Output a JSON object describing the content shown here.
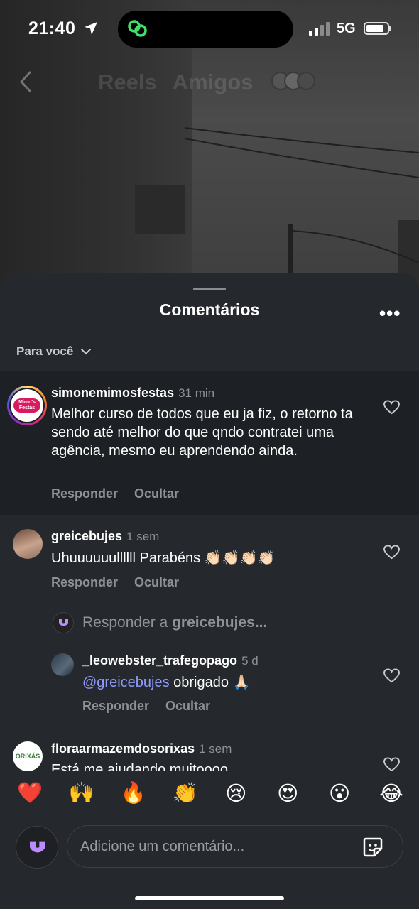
{
  "status_bar": {
    "time": "21:40",
    "network": "5G"
  },
  "reel_header": {
    "tabs": [
      "Reels",
      "Amigos"
    ]
  },
  "sheet": {
    "title": "Comentários",
    "more": "•••",
    "filter_label": "Para você"
  },
  "comments": [
    {
      "username": "simonemimosfestas",
      "time": "31 min",
      "text": "Melhor curso de todos que eu ja fiz, o retorno ta sendo até melhor do que qndo contratei uma agência,  mesmo eu aprendendo ainda.",
      "reply_label": "Responder",
      "hide_label": "Ocultar",
      "avatar_text": "Mimo's Festas"
    },
    {
      "username": "greicebujes",
      "time": "1 sem",
      "text": "Uhuuuuuullllll Parabéns 👏🏻👏🏻👏🏻👏🏻",
      "reply_label": "Responder",
      "hide_label": "Ocultar"
    }
  ],
  "reply_prompt": {
    "prefix": "Responder a ",
    "user": "greicebujes..."
  },
  "reply": {
    "username": "_leowebster_trafegopago",
    "time": "5 d",
    "mention": "@greicebujes",
    "text": " obrigado 🙏🏻",
    "reply_label": "Responder",
    "hide_label": "Ocultar"
  },
  "partial_comment": {
    "username": "floraarmazemdosorixas",
    "time": "1 sem",
    "text": "Está me ajudando muitoooo",
    "avatar_text": "ORIXÁS"
  },
  "emoji_bar": [
    "❤️",
    "🙌",
    "🔥",
    "👏",
    "😢",
    "😍",
    "😮",
    "😂"
  ],
  "composer": {
    "placeholder": "Adicione um comentário..."
  }
}
